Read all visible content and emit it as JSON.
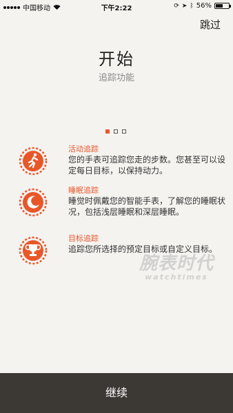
{
  "status_bar": {
    "carrier": "中国移动",
    "time": "下午2:22",
    "battery_text": "56%",
    "battery_level": 0.56,
    "icons": [
      "signal-icon",
      "wifi-icon",
      "lock-rotation-icon",
      "location-icon",
      "bluetooth-icon",
      "battery-icon"
    ]
  },
  "header": {
    "skip_label": "跳过"
  },
  "intro": {
    "title": "开始",
    "subtitle": "追踪功能"
  },
  "pager": {
    "total": 3,
    "current": 1
  },
  "features": [
    {
      "icon": "running-person-icon",
      "title": "活动追踪",
      "description": "您的手表可追踪您走的步数。您甚至可以设定每日目标，以保持动力。"
    },
    {
      "icon": "moon-icon",
      "title": "睡眠追踪",
      "description": "睡觉时佩戴您的智能手表，了解您的睡眠状况，包括浅层睡眠和深层睡眠。"
    },
    {
      "icon": "trophy-icon",
      "title": "目标追踪",
      "description": "追踪您所选择的预定目标或自定义目标。"
    }
  ],
  "watermark": {
    "cn": "腕表时代",
    "en": "watchtimes"
  },
  "footer": {
    "continue_label": "继续"
  },
  "colors": {
    "accent": "#e8572a",
    "background": "#f4f3f0",
    "footer_bg": "#3c3834"
  }
}
